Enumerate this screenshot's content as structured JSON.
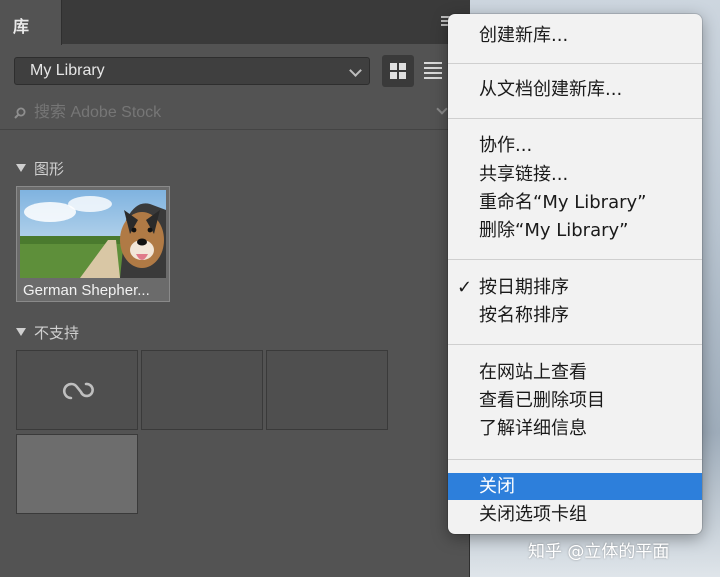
{
  "panel": {
    "tab_label": "库",
    "library_select": "My Library",
    "search_placeholder": "搜索 Adobe Stock"
  },
  "sections": [
    {
      "title": "图形",
      "items": [
        {
          "label": "German Shepher..."
        }
      ]
    },
    {
      "title": "不支持"
    }
  ],
  "context_menu": {
    "items": [
      {
        "label": "创建新库..."
      },
      {
        "label": "从文档创建新库..."
      },
      {
        "label": "协作..."
      },
      {
        "label": "共享链接..."
      },
      {
        "label": "重命名“My Library”"
      },
      {
        "label": "删除“My Library”"
      },
      {
        "label": "按日期排序",
        "checked": true
      },
      {
        "label": "按名称排序"
      },
      {
        "label": "在网站上查看"
      },
      {
        "label": "查看已删除项目"
      },
      {
        "label": "了解详细信息"
      },
      {
        "label": "关闭",
        "highlighted": true
      },
      {
        "label": "关闭选项卡组"
      }
    ],
    "checkmark": "✓"
  },
  "watermark": "知乎 @立体的平面",
  "colors": {
    "panel_bg": "#535353",
    "menu_bg": "#f2f2f2",
    "highlight": "#2d7fdb"
  }
}
